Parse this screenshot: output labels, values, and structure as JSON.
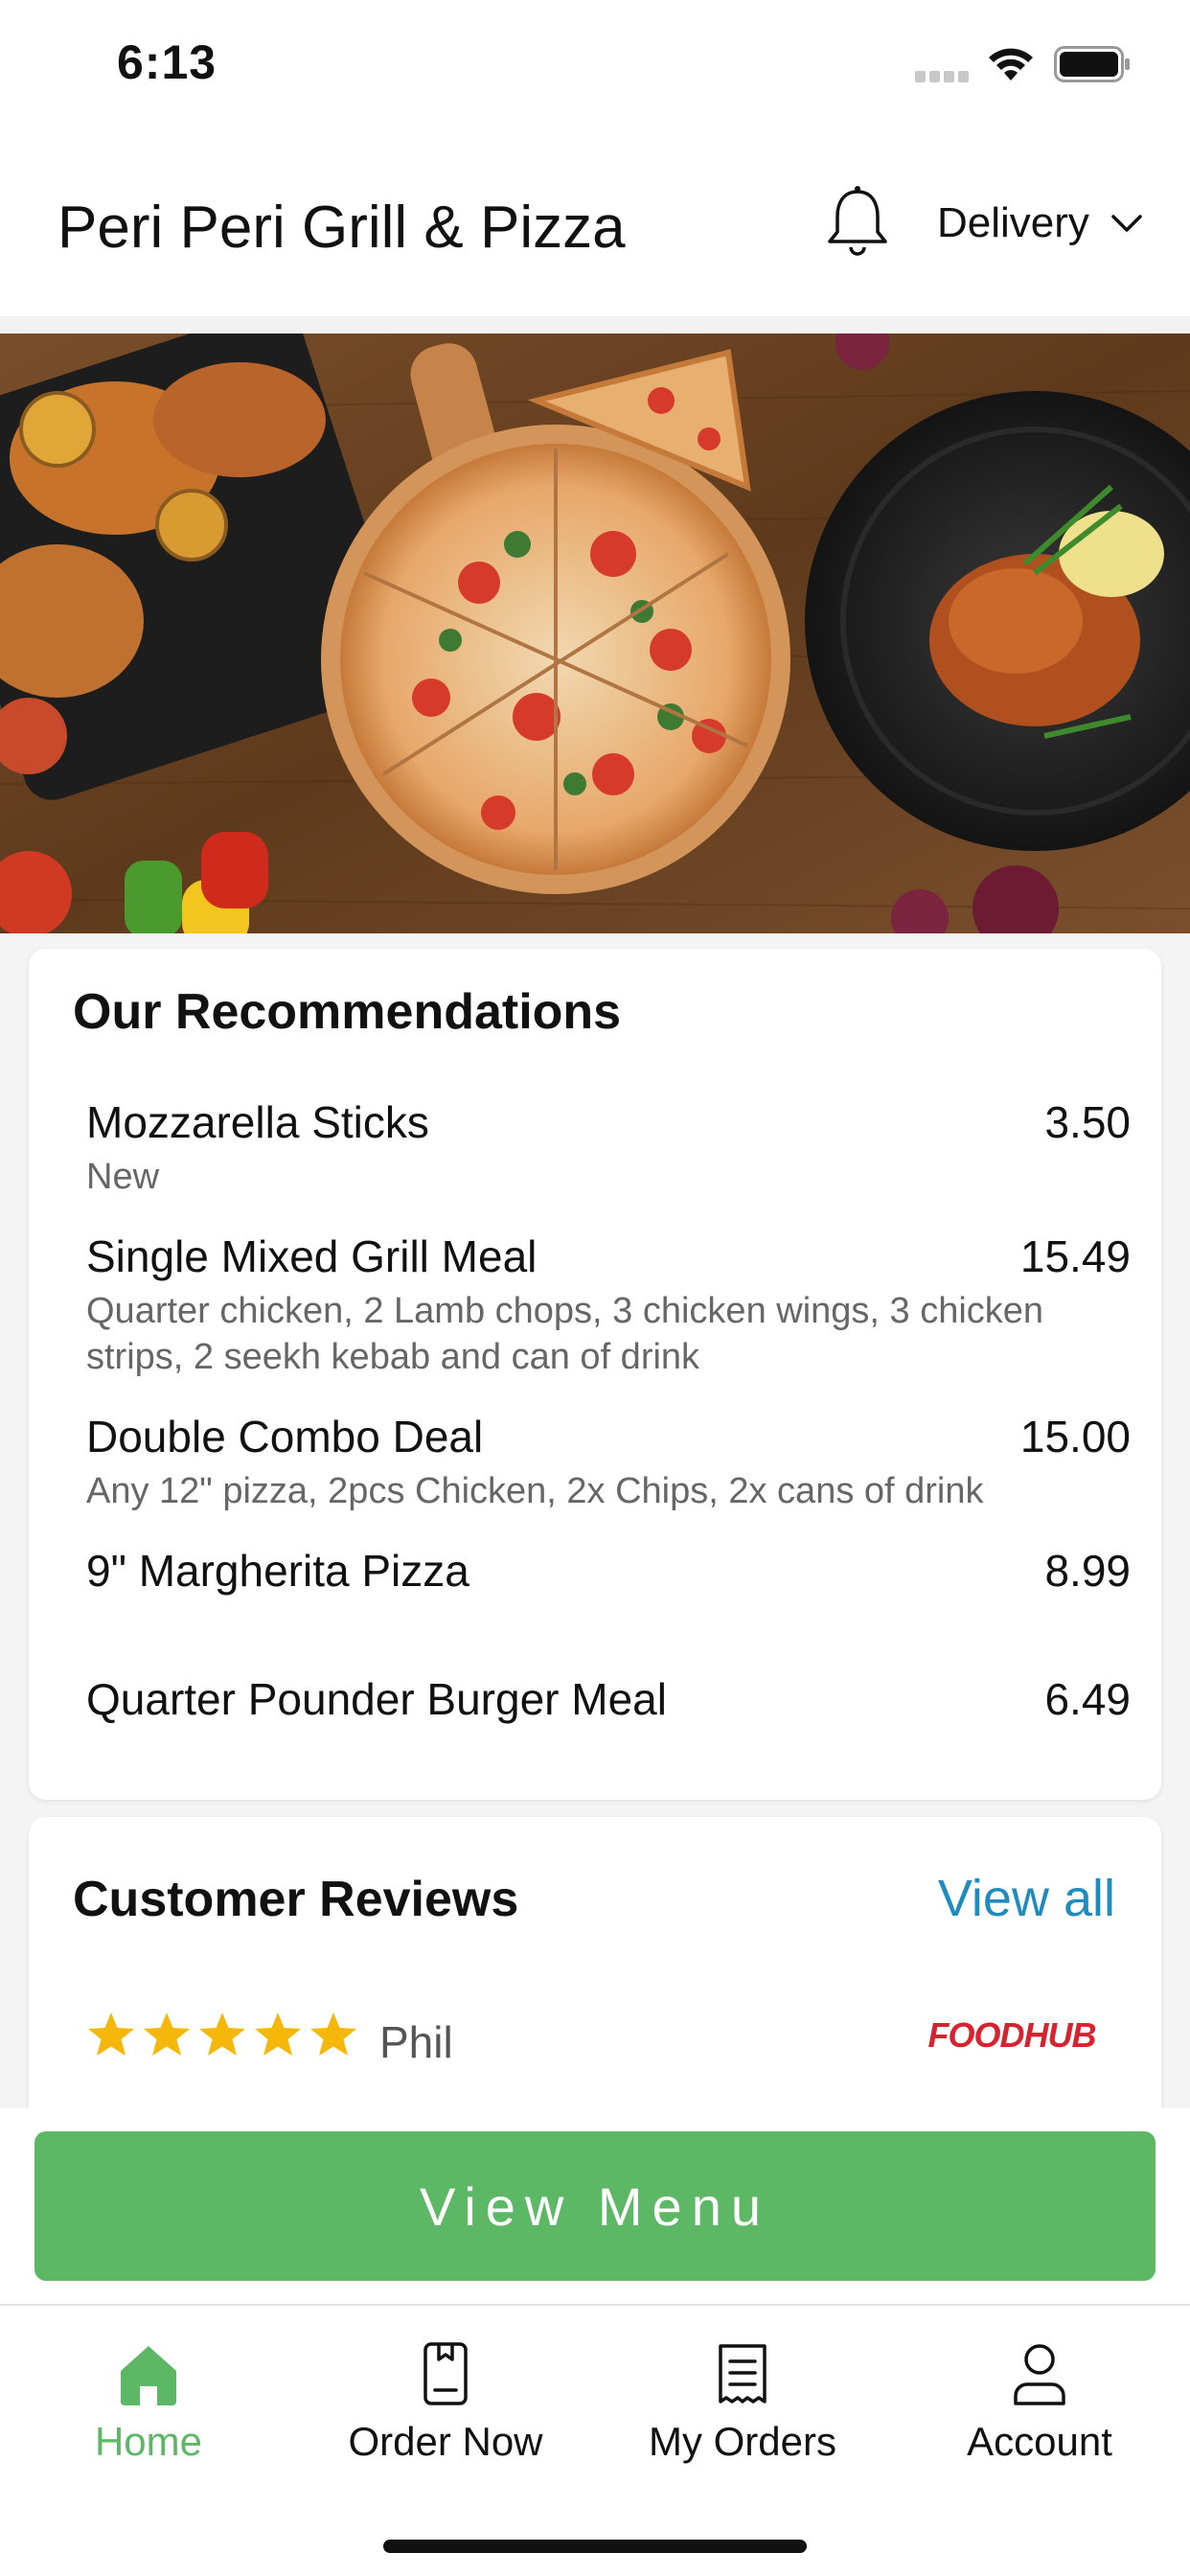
{
  "status_bar": {
    "time": "6:13"
  },
  "header": {
    "title": "Peri Peri Grill & Pizza",
    "mode_label": "Delivery"
  },
  "recommendations": {
    "title": "Our Recommendations",
    "items": [
      {
        "name": "Mozzarella Sticks",
        "price": "3.50",
        "desc": "New"
      },
      {
        "name": "Single Mixed Grill Meal",
        "price": "15.49",
        "desc": "Quarter chicken, 2 Lamb chops, 3 chicken wings, 3 chicken strips, 2 seekh kebab and can of drink"
      },
      {
        "name": "Double Combo Deal",
        "price": "15.00",
        "desc": "Any 12\" pizza, 2pcs Chicken, 2x Chips, 2x cans of drink"
      },
      {
        "name": "9\" Margherita Pizza",
        "price": "8.99",
        "desc": ""
      },
      {
        "name": "Quarter Pounder Burger Meal",
        "price": "6.49",
        "desc": ""
      }
    ]
  },
  "reviews": {
    "title": "Customer Reviews",
    "view_all": "View all",
    "first": {
      "reviewer": "Phil",
      "rating": 5,
      "source_logo": "FOODHUB"
    }
  },
  "cta": {
    "label": "View Menu"
  },
  "tabs": [
    {
      "label": "Home",
      "icon": "home-icon",
      "active": true
    },
    {
      "label": "Order Now",
      "icon": "order-icon",
      "active": false
    },
    {
      "label": "My Orders",
      "icon": "receipt-icon",
      "active": false
    },
    {
      "label": "Account",
      "icon": "user-icon",
      "active": false
    }
  ],
  "colors": {
    "accent_green": "#5cb865",
    "link_blue": "#1f8bbf",
    "foodhub_red": "#d6232f"
  }
}
